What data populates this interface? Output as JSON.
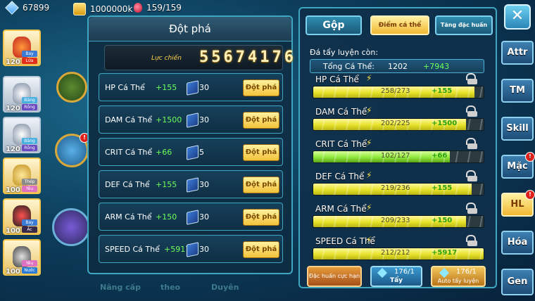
{
  "resources": {
    "gems": "67899",
    "gold": "1000000k",
    "stamina": "159/159"
  },
  "breakthrough": {
    "title": "Đột phá",
    "power_label": "Lực chiến",
    "power_value": "55674176",
    "rows": [
      {
        "name": "HP Cá Thể",
        "bonus": "+155",
        "cost": "30",
        "button": "Đột phá"
      },
      {
        "name": "DAM Cá Thể",
        "bonus": "+1500",
        "cost": "30",
        "button": "Đột phá"
      },
      {
        "name": "CRIT Cá Thể",
        "bonus": "+66",
        "cost": "5",
        "button": "Đột phá"
      },
      {
        "name": "DEF Cá Thể",
        "bonus": "+155",
        "cost": "30",
        "button": "Đột phá"
      },
      {
        "name": "ARM Cá Thể",
        "bonus": "+150",
        "cost": "30",
        "button": "Đột phá"
      },
      {
        "name": "SPEED Cá Thể",
        "bonus": "+5917",
        "cost": "30",
        "button": "Đột phá"
      }
    ]
  },
  "training": {
    "tabs": [
      "Gộp",
      "Điểm cá thể",
      "Tăng đặc huấn"
    ],
    "remaining_label": "Đá tẩy luyện còn:",
    "total_label": "Tổng Cá Thể:",
    "total_value": "1202",
    "total_bonus": "+7943",
    "stats": [
      {
        "name": "HP Cá Thể",
        "current": 258,
        "max": 273,
        "frac": "258/273",
        "bonus": "+155",
        "color": "yellow"
      },
      {
        "name": "DAM Cá Thể",
        "current": 202,
        "max": 225,
        "frac": "202/225",
        "bonus": "+1500",
        "color": "yellow"
      },
      {
        "name": "CRIT Cá Thể",
        "current": 102,
        "max": 127,
        "frac": "102/127",
        "bonus": "+66",
        "color": "green"
      },
      {
        "name": "DEF Cá Thể",
        "current": 219,
        "max": 236,
        "frac": "219/236",
        "bonus": "+155",
        "color": "yellow"
      },
      {
        "name": "ARM Cá Thể",
        "current": 209,
        "max": 233,
        "frac": "209/233",
        "bonus": "+150",
        "color": "yellow"
      },
      {
        "name": "SPEED Cá Thể",
        "current": 212,
        "max": 212,
        "frac": "212/212",
        "bonus": "+5917",
        "color": "yellow"
      }
    ],
    "buttons": {
      "special": "Đặc huấn cực hạn",
      "wash_count": "176/1",
      "wash_label": "Tẩy",
      "auto_count": "176/1",
      "auto_label": "Auto tẩy luyện"
    }
  },
  "side_tabs": [
    "Attr",
    "TM",
    "Skill",
    "Mặc",
    "HL",
    "Hóa",
    "Gen"
  ],
  "side_badges": {
    "Mặc": "!",
    "HL": "!"
  },
  "close_icon": "close-icon",
  "pets": [
    {
      "level": "120",
      "tags": [
        "Bay",
        "Lửa"
      ]
    },
    {
      "level": "120",
      "tags": [
        "Băng",
        "Rồng"
      ]
    },
    {
      "level": "120",
      "tags": [
        "Băng",
        "Rồng"
      ]
    },
    {
      "level": "100",
      "tags": [
        "Thép",
        "Yêu"
      ]
    },
    {
      "level": "100",
      "tags": [
        "Bay",
        "Ác"
      ]
    },
    {
      "level": "100",
      "tags": [
        "Yêu",
        "Nước"
      ]
    }
  ],
  "left_badge": "!",
  "bottom_tabs": [
    "Nâng cấp",
    "theo",
    "Duyên"
  ],
  "colors": {
    "accent": "#3fa6c2",
    "gold": "#f2c23a",
    "bonus_green": "#6cff5a"
  }
}
